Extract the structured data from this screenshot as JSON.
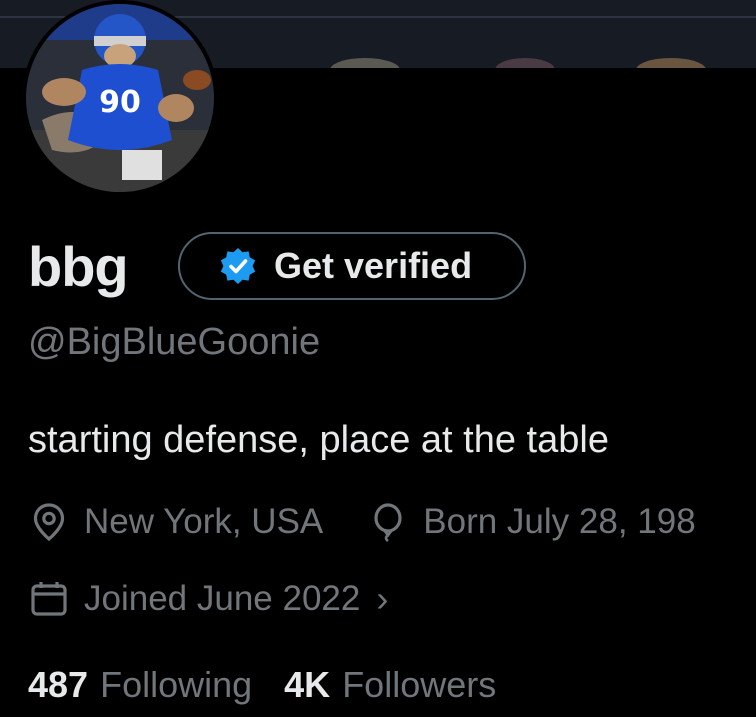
{
  "profile": {
    "display_name": "bbg",
    "handle": "@BigBlueGoonie",
    "bio": "starting defense, place at the table",
    "verify_button_label": "Get verified",
    "avatar_icon": "football-player-mascot-avatar"
  },
  "meta": {
    "location": "New York, USA",
    "birthday": "Born July 28, 198",
    "joined": "Joined June 2022"
  },
  "stats": {
    "following_count": "487",
    "following_label": "Following",
    "followers_count": "4K",
    "followers_label": "Followers"
  },
  "colors": {
    "background": "#000000",
    "primary_text": "#e7e9ea",
    "secondary_text": "#71767b",
    "border": "#536471",
    "verified_blue": "#1d9bf0"
  }
}
